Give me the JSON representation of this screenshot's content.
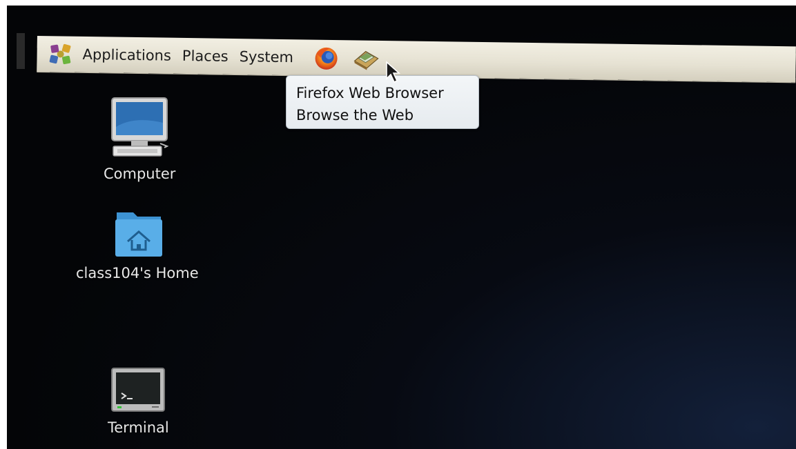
{
  "panel": {
    "menus": [
      {
        "label": "Applications"
      },
      {
        "label": "Places"
      },
      {
        "label": "System"
      }
    ],
    "launchers": [
      {
        "icon": "firefox-icon"
      },
      {
        "icon": "mail-icon"
      }
    ]
  },
  "tooltip": {
    "title": "Firefox Web Browser",
    "description": "Browse the Web"
  },
  "desktop": {
    "icons": [
      {
        "icon": "computer-icon",
        "label": "Computer"
      },
      {
        "icon": "home-folder-icon",
        "label": "class104's Home"
      },
      {
        "icon": "terminal-icon",
        "label": "Terminal"
      }
    ]
  },
  "colors": {
    "panel_bg": "#e6e2d3",
    "tooltip_bg": "#eef2f5",
    "desktop_bg": "#05070c",
    "folder_blue": "#4aa3df"
  }
}
